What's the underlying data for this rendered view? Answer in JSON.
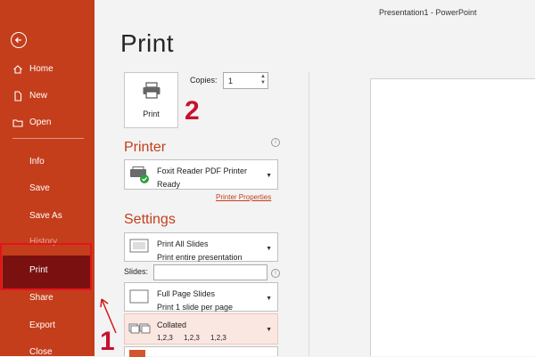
{
  "window": {
    "title": "Presentation1  -  PowerPoint"
  },
  "sidebar": {
    "items": [
      {
        "label": "Home"
      },
      {
        "label": "New"
      },
      {
        "label": "Open"
      },
      {
        "label": "Info"
      },
      {
        "label": "Save"
      },
      {
        "label": "Save As"
      },
      {
        "label": "History"
      },
      {
        "label": "Print"
      },
      {
        "label": "Share"
      },
      {
        "label": "Export"
      },
      {
        "label": "Close"
      }
    ]
  },
  "print": {
    "title": "Print",
    "button_label": "Print",
    "copies_label": "Copies:",
    "copies_value": "1"
  },
  "printer": {
    "heading": "Printer",
    "name": "Foxit Reader PDF Printer",
    "status": "Ready",
    "properties_link": "Printer Properties"
  },
  "settings": {
    "heading": "Settings",
    "range_title": "Print All Slides",
    "range_desc": "Print entire presentation",
    "slides_label": "Slides:",
    "slides_value": "",
    "layout_title": "Full Page Slides",
    "layout_desc": "Print 1 slide per page",
    "collate_title": "Collated",
    "collate_seq": "1,2,3   1,2,3   1,2,3"
  },
  "annotations": {
    "step1": "1",
    "step2": "2"
  },
  "colors": {
    "brand": "#c43e1c",
    "active": "#7a1110",
    "annotation": "#e4131c"
  }
}
